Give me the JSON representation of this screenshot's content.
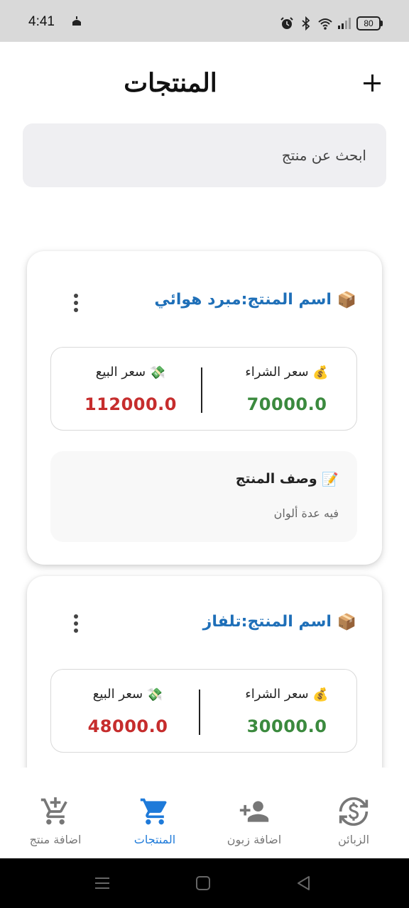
{
  "status_bar": {
    "time": "4:41",
    "battery": "80",
    "icons": [
      "mosque-icon",
      "alarm-icon",
      "bluetooth-icon",
      "wifi-icon",
      "signal-icon",
      "battery-icon"
    ]
  },
  "header": {
    "title": "المنتجات",
    "add_icon": "plus-icon"
  },
  "search": {
    "placeholder": "ابحث عن منتج"
  },
  "products": [
    {
      "name": "اسم المنتج:مبرد هوائي",
      "name_icon": "package-icon",
      "buy_label": "سعر الشراء",
      "buy_icon": "money-bag-icon",
      "buy_price": "70000.0",
      "sell_label": "سعر البيع",
      "sell_icon": "money-wings-icon",
      "sell_price": "112000.0",
      "desc_title": "وصف المنتج",
      "desc_icon": "memo-icon",
      "desc_text": "فيه عدة ألوان"
    },
    {
      "name": "اسم المنتج:تلفاز",
      "name_icon": "package-icon",
      "buy_label": "سعر الشراء",
      "buy_icon": "money-bag-icon",
      "buy_price": "30000.0",
      "sell_label": "سعر البيع",
      "sell_icon": "money-wings-icon",
      "sell_price": "48000.0"
    }
  ],
  "bottom_nav": {
    "items": [
      {
        "label": "اضافة منتج",
        "icon": "add-cart-icon",
        "active": false
      },
      {
        "label": "المنتجات",
        "icon": "cart-icon",
        "active": true
      },
      {
        "label": "اضافة زبون",
        "icon": "add-person-icon",
        "active": false
      },
      {
        "label": "الزبائن",
        "icon": "currency-exchange-icon",
        "active": false
      }
    ]
  },
  "colors": {
    "accent": "#1e7ad9",
    "title_blue": "#1e6fb8",
    "buy_green": "#3b8a3e",
    "sell_red": "#c62d2d",
    "search_bg": "#efeff2"
  }
}
